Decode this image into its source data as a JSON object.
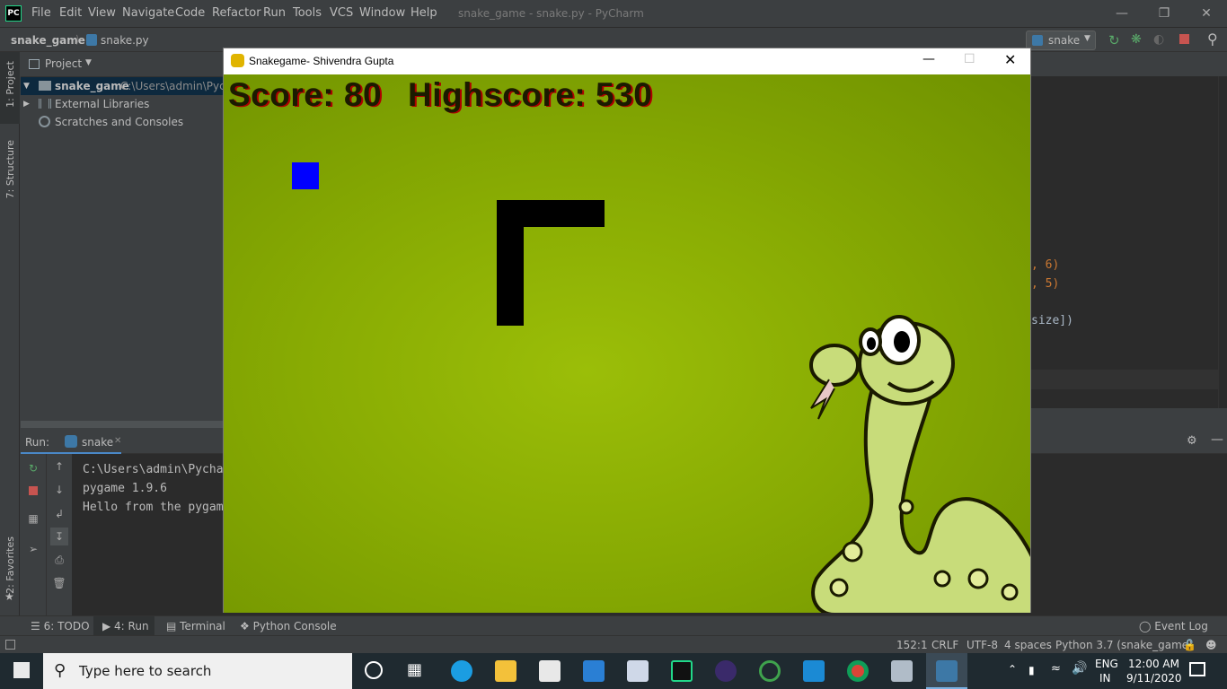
{
  "titlebar": {
    "logo": "PC",
    "menu": [
      "File",
      "Edit",
      "View",
      "Navigate",
      "Code",
      "Refactor",
      "Run",
      "Tools",
      "VCS",
      "Window",
      "Help"
    ],
    "title": "snake_game - snake.py - PyCharm"
  },
  "navbar": {
    "project": "snake_game",
    "file": "snake.py",
    "run_config": "snake"
  },
  "left_strip": {
    "project_tab": "1: Project",
    "structure_tab": "7: Structure",
    "favorites_tab": "2: Favorites"
  },
  "project_panel": {
    "header": "Project",
    "items": [
      {
        "label": "snake_game",
        "path": "C:\\Users\\admin\\Pych"
      },
      {
        "label": "External Libraries"
      },
      {
        "label": "Scratches and Consoles"
      }
    ]
  },
  "editor": {
    "fragments": [
      ", 6)",
      ", 5)",
      "size])"
    ]
  },
  "run_panel": {
    "label": "Run:",
    "tab": "snake",
    "lines": [
      "C:\\Users\\admin\\Pycha",
      "pygame 1.9.6",
      "Hello from the pygam"
    ]
  },
  "bottom_tabs": [
    "6: TODO",
    "4: Run",
    "Terminal",
    "Python Console"
  ],
  "event_log": "Event Log",
  "status": {
    "position": "152:1",
    "line_sep": "CRLF",
    "encoding": "UTF-8",
    "indent": "4 spaces",
    "interpreter": "Python 3.7 (snake_game)"
  },
  "game": {
    "window_title": "Snakegame- Shivendra Gupta",
    "score_label": "Score: 80",
    "highscore_label": "Highscore: 530",
    "score": 80,
    "highscore": 530,
    "background_color": "#8aad04",
    "snake_color": "#000000",
    "food_color": "#0000ff"
  },
  "taskbar": {
    "search_placeholder": "Type here to search",
    "lang1": "ENG",
    "lang2": "IN",
    "time": "12:00 AM",
    "date": "9/11/2020"
  }
}
